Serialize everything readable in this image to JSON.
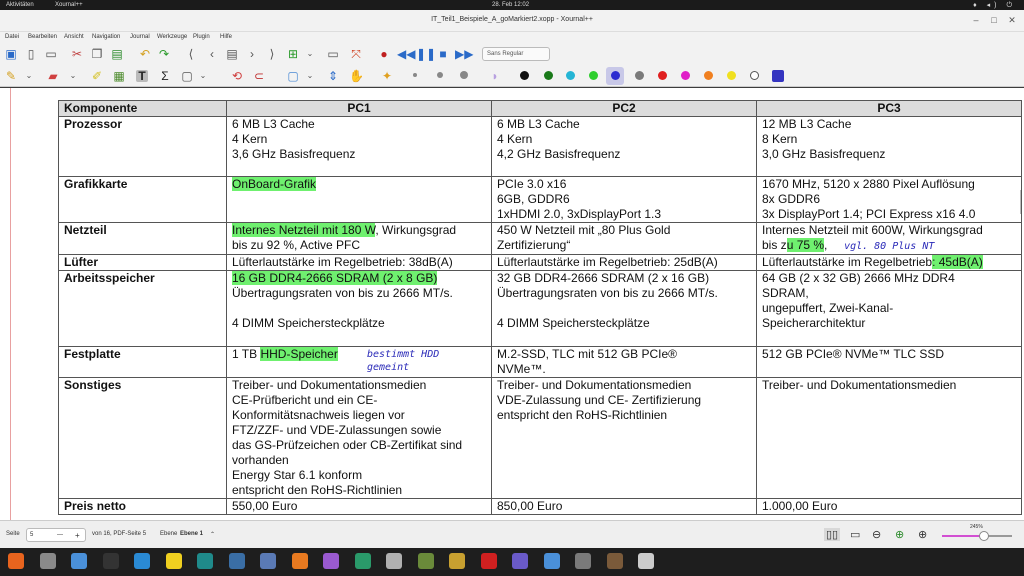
{
  "topbar": {
    "activities": "Aktivitäten",
    "app_name": "Xournal++",
    "clock": "28. Feb  12:02",
    "sys_icons": "♦ ◂) ⏻"
  },
  "window": {
    "title": "IT_Teil1_Beispiele_A_goMarkiert2.xopp - Xournal++"
  },
  "menu": [
    "Datei",
    "Bearbeiten",
    "Ansicht",
    "Navigation",
    "Journal",
    "Werkzeuge",
    "Plugin",
    "Hilfe"
  ],
  "toolbar": {
    "font": "Sans Regular"
  },
  "pen_colors": [
    "#111111",
    "#1a7a1a",
    "#25b5d5",
    "#2fce2f",
    "#2b2bd0",
    "#7a7a7a",
    "#e02020",
    "#e020c8",
    "#f08020",
    "#f0e020",
    "#ffffff",
    "#3535c0"
  ],
  "table": {
    "headers": [
      "Komponente",
      "PC1",
      "PC2",
      "PC3"
    ],
    "rows": [
      {
        "label": "Prozessor",
        "pc1": [
          "6 MB L3 Cache",
          "4 Kern",
          "3,6 GHz Basisfrequenz"
        ],
        "pc2": [
          "6 MB L3 Cache",
          "4 Kern",
          "4,2 GHz Basisfrequenz"
        ],
        "pc3": [
          "12 MB L3 Cache",
          "8 Kern",
          "3,0 GHz Basisfrequenz"
        ]
      },
      {
        "label": "Grafikkarte",
        "pc1_hl": "OnBoard-Grafik",
        "pc2": [
          "PCIe 3.0 x16",
          "6GB, GDDR6",
          "1xHDMI 2.0, 3xDisplayPort 1.3"
        ],
        "pc3": [
          "1670 MHz, 5120 x 2880 Pixel Auflösung",
          "8x GDDR6",
          "3x DisplayPort 1.4; PCI Express x16 4.0"
        ]
      },
      {
        "label": "Netzteil",
        "pc1_hl": "Internes Netzteil mit 180 W",
        "pc1_rest": ", Wirkungsgrad",
        "pc1_line2": "bis zu 92 %, Active PFC",
        "pc2": [
          "450 W Netzteil mit „80 Plus Gold",
          "Zertifizierung“"
        ],
        "pc3_line1": "Internes Netzteil mit 600W, Wirkungsgrad",
        "pc3_pre": "bis z",
        "pc3_hl": "u 75 %",
        "pc3_post": ",",
        "pc3_note": "vgl. 80 Plus NT"
      },
      {
        "label": "Lüfter",
        "pc1": "Lüfterlautstärke im Regelbetrieb: 38dB(A)",
        "pc2": "Lüfterlautstärke im Regelbetrieb: 25dB(A)",
        "pc3_pre": "Lüfterlautstärke im Regelbetrieb",
        "pc3_hl": ": 45dB(A)"
      },
      {
        "label": "Arbeitsspeicher",
        "pc1_hl": "16 GB DDR4-2666 SDRAM (2 x 8 GB)",
        "pc1": [
          "Übertragungsraten von bis zu 2666 MT/s.",
          "",
          "4 DIMM Speichersteckplätze"
        ],
        "pc2": [
          "32 GB DDR4-2666 SDRAM (2 x 16 GB)",
          "Übertragungsraten von bis zu 2666 MT/s.",
          "",
          "4 DIMM Speichersteckplätze"
        ],
        "pc3": [
          "64 GB (2 x 32 GB) 2666 MHz DDR4",
          "SDRAM,",
          "ungepuffert, Zwei-Kanal-",
          "Speicherarchitektur"
        ]
      },
      {
        "label": "Festplatte",
        "pc1_pre": "1 TB ",
        "pc1_hl": "HHD-Speicher",
        "pc1_note": [
          "bestimmt HDD",
          "gemeint"
        ],
        "pc2": [
          "M.2-SSD, TLC mit 512 GB PCIe®",
          "NVMe™."
        ],
        "pc3": "512 GB PCIe® NVMe™ TLC SSD"
      },
      {
        "label": "Sonstiges",
        "pc1": [
          "Treiber- und Dokumentationsmedien",
          "CE-Prüfbericht und ein CE-",
          "Konformitätsnachweis liegen vor",
          "FTZ/ZZF- und VDE-Zulassungen sowie",
          "das GS-Prüfzeichen oder CB-Zertifikat sind",
          "vorhanden",
          "Energy Star 6.1 konform",
          "entspricht den RoHS-Richtlinien"
        ],
        "pc2": [
          "Treiber- und Dokumentationsmedien",
          "VDE-Zulassung und CE- Zertifizierung",
          "entspricht den RoHS-Richtlinien"
        ],
        "pc3": "Treiber- und Dokumentationsmedien"
      },
      {
        "label": "Preis netto",
        "pc1": "550,00 Euro",
        "pc2": "850,00 Euro",
        "pc3": "1.000,00 Euro"
      }
    ]
  },
  "status": {
    "page_label": "Seite",
    "page_value": "5",
    "minus": "—",
    "plus": "+",
    "page_of": "von 16, PDF-Seite 5",
    "layer_label": "Ebene",
    "layer_value": "Ebene 1",
    "layer_arrow": "⌃",
    "zoom": "245%",
    "zoom_fraction": 0.6
  },
  "taskbar_colors": [
    "#e8641e",
    "#8a8a8a",
    "#4a90d9",
    "#333333",
    "#2a8ad4",
    "#f0d020",
    "#1f8a8a",
    "#3a6ea5",
    "#5a7ab5",
    "#e87a20",
    "#9a5ad0",
    "#2a9a6a",
    "#b0b0b0",
    "#6a8a3a",
    "#c8a030",
    "#d02020",
    "#6a5ac8",
    "#4a90d9",
    "#7a7a7a",
    "#7a5a3a",
    "#cccccc"
  ]
}
